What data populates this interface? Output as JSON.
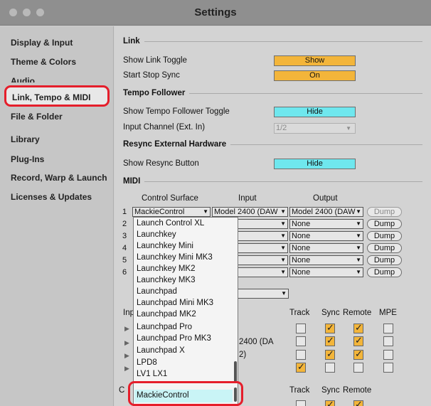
{
  "window": {
    "title": "Settings"
  },
  "sidebar": {
    "items": [
      {
        "label": "Display & Input"
      },
      {
        "label": "Theme & Colors"
      },
      {
        "label": "Audio"
      },
      {
        "label": "Link, Tempo & MIDI"
      },
      {
        "label": "File & Folder"
      },
      {
        "label": "Library"
      },
      {
        "label": "Plug-Ins"
      },
      {
        "label": "Record, Warp & Launch"
      },
      {
        "label": "Licenses & Updates"
      }
    ]
  },
  "link": {
    "header": "Link",
    "show_link_toggle": {
      "label": "Show Link Toggle",
      "value": "Show"
    },
    "start_stop_sync": {
      "label": "Start Stop Sync",
      "value": "On"
    }
  },
  "tempo": {
    "header": "Tempo Follower",
    "show_toggle": {
      "label": "Show Tempo Follower Toggle",
      "value": "Hide"
    },
    "input_channel": {
      "label": "Input Channel (Ext. In)",
      "value": "1/2"
    }
  },
  "resync": {
    "header": "Resync External Hardware",
    "show_button": {
      "label": "Show Resync Button",
      "value": "Hide"
    }
  },
  "midi": {
    "header": "MIDI",
    "col_control_surface": "Control Surface",
    "col_input": "Input",
    "col_output": "Output",
    "dump_label": "Dump",
    "surfaces": [
      {
        "num": "1",
        "surface": "MackieControl",
        "input": "Model 2400 (DAW",
        "output": "Model 2400 (DAW"
      },
      {
        "num": "2",
        "surface": "",
        "input": "",
        "output": "None"
      },
      {
        "num": "3",
        "surface": "",
        "input": "",
        "output": "None"
      },
      {
        "num": "4",
        "surface": "",
        "input": "",
        "output": "None"
      },
      {
        "num": "5",
        "surface": "",
        "input": "",
        "output": "None"
      },
      {
        "num": "6",
        "surface": "",
        "input": "",
        "output": "None"
      }
    ],
    "ports_header_partial": "Inp",
    "ports_cols": {
      "track": "Track",
      "sync": "Sync",
      "remote": "Remote",
      "mpe": "MPE"
    },
    "port_fragment_1": "2400 (DA",
    "port_fragment_2": "2)",
    "output_partial": "C"
  },
  "popup": {
    "options": [
      "Launch Control XL",
      "Launchkey",
      "Launchkey Mini",
      "Launchkey Mini MK3",
      "Launchkey MK2",
      "Launchkey MK3",
      "Launchpad",
      "Launchpad Mini MK3",
      "Launchpad MK2",
      "Launchpad Pro",
      "Launchpad Pro MK3",
      "Launchpad X",
      "LPD8",
      "LV1 LX1"
    ],
    "highlighted": "MackieControl"
  },
  "colors": {
    "accent_orange": "#f3b53a",
    "accent_cyan": "#6fe7ee",
    "annotation_red": "#e51e2b"
  }
}
